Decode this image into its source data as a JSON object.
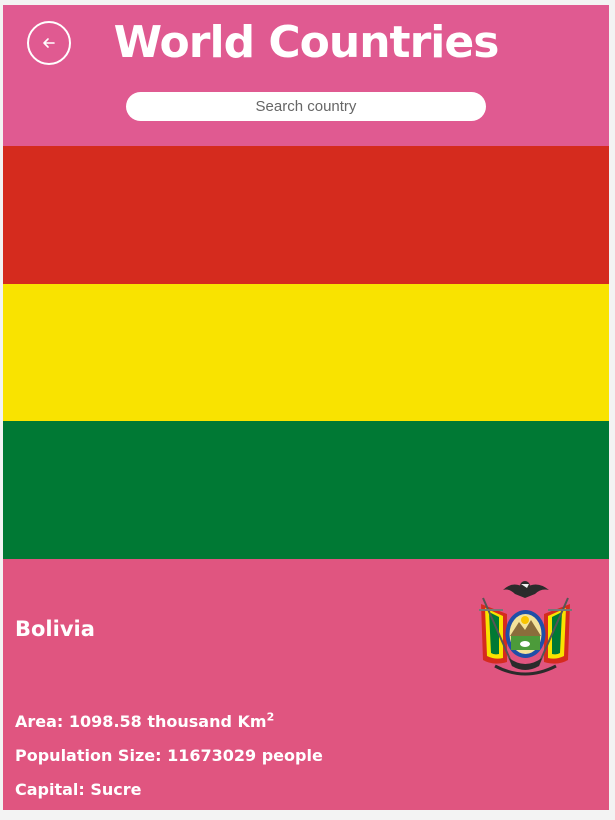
{
  "header": {
    "title": "World Countries",
    "back_icon": "arrow-left-icon",
    "search": {
      "placeholder": "Search country",
      "value": ""
    }
  },
  "flag": {
    "stripes": [
      "#d52b1e",
      "#f9e300",
      "#007934"
    ]
  },
  "country": {
    "name": "Bolivia",
    "emblem_icon": "coat-of-arms-icon",
    "area_label": "Area:",
    "area_value": "1098.58 thousand Km",
    "area_exponent": "2",
    "population_label": "Population Size:",
    "population_value": "11673029 people",
    "capital_label": "Capital:",
    "capital_value": "Sucre"
  },
  "colors": {
    "header_bg": "#e05a91",
    "info_bg": "#e05580",
    "text": "#ffffff"
  }
}
